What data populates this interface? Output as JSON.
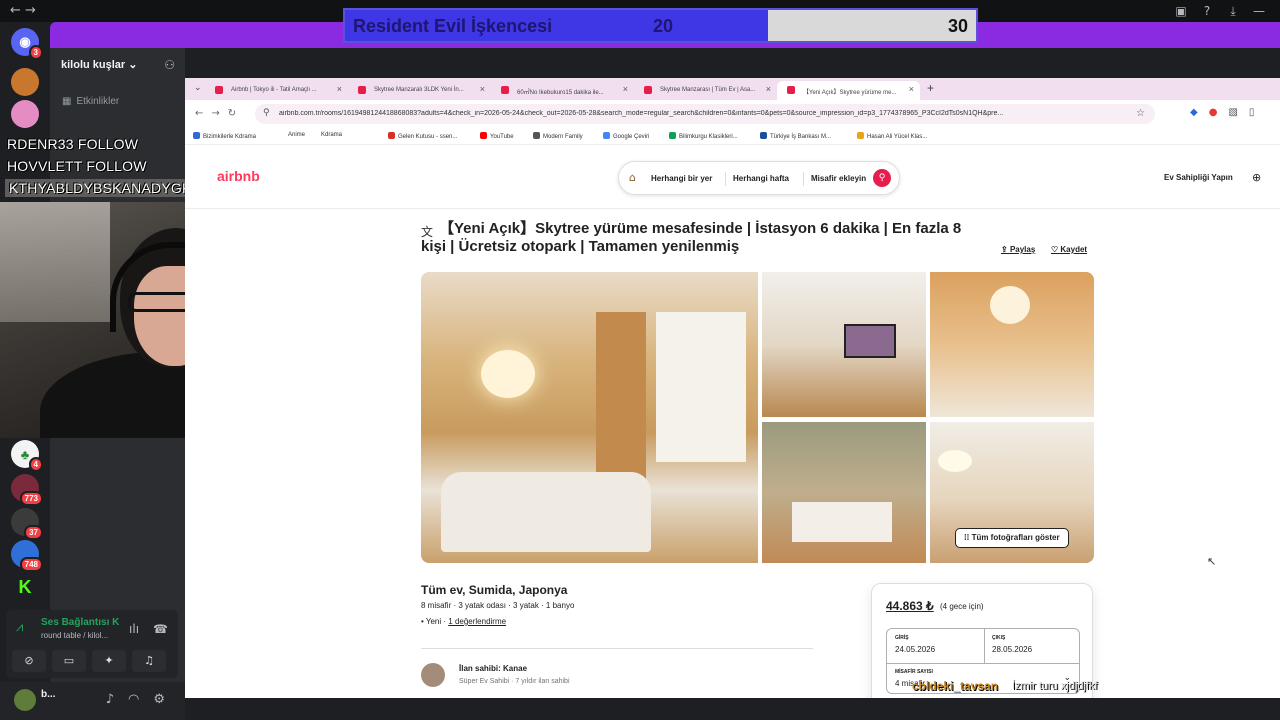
{
  "poll": {
    "title": "Resident Evil İşkencesi",
    "left_value": "20",
    "right_value": "30",
    "left_share": 0.4
  },
  "discord": {
    "guild_name": "kilolu kuşlar",
    "events_label": "Etkinlikler",
    "server_badges": [
      "3",
      "4",
      "773",
      "37",
      "748"
    ],
    "voice": {
      "status": "Ses Bağlantısı K",
      "channel": "round table / kilol..."
    },
    "user": {
      "name": "b..."
    }
  },
  "follows": [
    "RDENR33 FOLLOW",
    "HOVVLETT FOLLOW",
    "KTHYABLDYBSKANADYGKHNAKSN  FOLLOW"
  ],
  "browser": {
    "tabs": [
      "Airbnb | Tokyo ili - Tatil Amaçlı ...",
      "Skytree Manzaralı 3LDK Yeni İn...",
      "60㎡No Ikebukuro15 dakika ile...",
      "Skytree Manzarası | Tüm Ev | Asa...",
      "【Yeni Açık】Skytree yürüme me..."
    ],
    "url": "airbnb.com.tr/rooms/1619498124418868083?adults=4&check_in=2026-05-24&check_out=2026-05-28&search_mode=regular_search&children=0&infants=0&pets=0&source_impression_id=p3_1774378965_P3CcI2dTs0sN1QH&pre...",
    "bookmarks": [
      "Bizimkilerle Kdrama",
      "Anime",
      "Kdrama",
      "Gelen Kutusu - ssen...",
      "YouTube",
      "Modern Family",
      "Google Çeviri",
      "Bilimkurgu Klasikleri...",
      "Türkiye İş Bankası M...",
      "Hasan Ali Yücel Klas..."
    ]
  },
  "airbnb": {
    "logo": "airbnb",
    "search": {
      "where": "Herhangi bir yer",
      "when": "Herhangi hafta",
      "guests": "Misafir ekleyin"
    },
    "host_cta": "Ev Sahipliği Yapın",
    "title": "【Yeni Açık】Skytree yürüme mesafesinde | İstasyon 6 dakika | En fazla 8 kişi | Ücretsiz otopark | Tamamen yenilenmiş",
    "share": "Paylaş",
    "save": "Kaydet",
    "show_all_photos": "Tüm fotoğrafları göster",
    "location": "Tüm ev, Sumida, Japonya",
    "meta": "8 misafir · 3 yatak odası · 3 yatak · 1 banyo",
    "new_label": "• Yeni · ",
    "reviews": "1 değerlendirme",
    "host": {
      "name": "İlan sahibi: Kanae",
      "sub": "Süper Ev Sahibi · 7 yıldır ilan sahibi"
    },
    "booking": {
      "price": "44.863 ₺",
      "per": "(4 gece için)",
      "checkin_label": "GİRİŞ",
      "checkin": "24.05.2026",
      "checkout_label": "ÇIKIŞ",
      "checkout": "28.05.2026",
      "guests_label": "MİSAFİR SAYISI",
      "guests": "4 misafir"
    }
  },
  "overlay": {
    "chat_name": "cbldeki_tavsan",
    "chat_msg": "İzmir turu xjdjdjfkf"
  }
}
